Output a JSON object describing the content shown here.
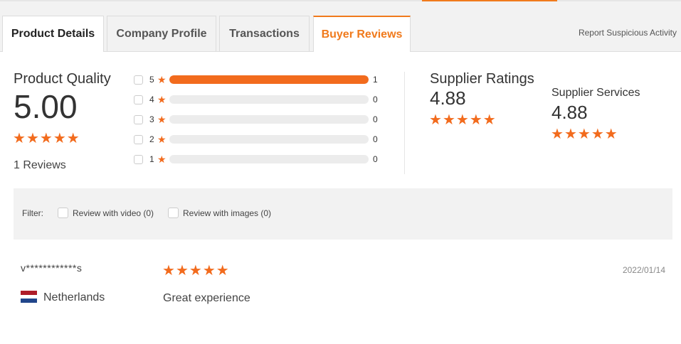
{
  "tabs": [
    {
      "label": "Product Details"
    },
    {
      "label": "Company Profile"
    },
    {
      "label": "Transactions"
    },
    {
      "label": "Buyer Reviews"
    }
  ],
  "report_link": "Report Suspicious Activity",
  "quality": {
    "title": "Product Quality",
    "score": "5.00",
    "reviews_label": "1 Reviews",
    "stars": 5
  },
  "breakdown": [
    {
      "stars": "5",
      "count": "1",
      "fraction": 1.0
    },
    {
      "stars": "4",
      "count": "0",
      "fraction": 0
    },
    {
      "stars": "3",
      "count": "0",
      "fraction": 0
    },
    {
      "stars": "2",
      "count": "0",
      "fraction": 0
    },
    {
      "stars": "1",
      "count": "0",
      "fraction": 0
    }
  ],
  "supplier_ratings": {
    "title": "Supplier Ratings",
    "score": "4.88",
    "stars": 5
  },
  "supplier_services": {
    "title": "Supplier Services",
    "score": "4.88",
    "stars": 5
  },
  "filter": {
    "label": "Filter:",
    "video": "Review with video (0)",
    "images": "Review with images (0)"
  },
  "review": {
    "user": "v************s",
    "country": "Netherlands",
    "text": "Great experience",
    "date": "2022/01/14",
    "stars": 5
  },
  "colors": {
    "accent": "#f07a1c",
    "star": "#f26b1d",
    "track": "#ececec"
  }
}
